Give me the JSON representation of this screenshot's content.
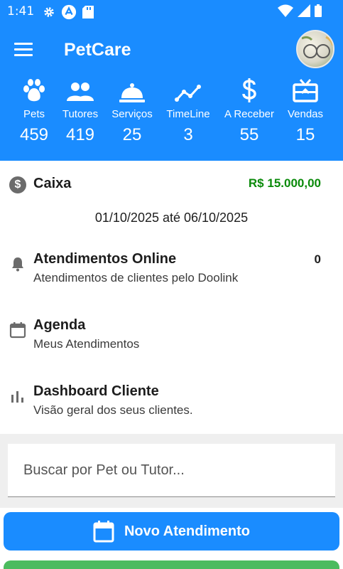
{
  "status_bar": {
    "time": "1:41"
  },
  "header": {
    "app_title": "PetCare"
  },
  "stats": [
    {
      "icon": "paw-icon",
      "label": "Pets",
      "value": "459"
    },
    {
      "icon": "people-icon",
      "label": "Tutores",
      "value": "419"
    },
    {
      "icon": "service-bell-icon",
      "label": "Serviços",
      "value": "25"
    },
    {
      "icon": "timeline-icon",
      "label": "TimeLine",
      "value": "3"
    },
    {
      "icon": "dollar-icon",
      "label": "A Receber",
      "value": "55"
    },
    {
      "icon": "gift-card-icon",
      "label": "Vendas",
      "value": "15"
    }
  ],
  "caixa": {
    "title": "Caixa",
    "value": "R$ 15.000,00",
    "period": "01/10/2025 até 06/10/2025"
  },
  "menu": [
    {
      "icon": "bell-icon",
      "title": "Atendimentos Online",
      "subtitle": "Atendimentos de clientes pelo Doolink",
      "count": "0"
    },
    {
      "icon": "calendar-icon",
      "title": "Agenda",
      "subtitle": "Meus Atendimentos"
    },
    {
      "icon": "bar-chart-icon",
      "title": "Dashboard Cliente",
      "subtitle": "Visão geral dos seus clientes."
    }
  ],
  "search": {
    "placeholder": "Buscar por Pet ou Tutor..."
  },
  "actions": {
    "novo_atendimento": "Novo Atendimento"
  },
  "colors": {
    "primary": "#1a8cff",
    "success": "#0a8a0a",
    "green_button": "#4cbb5f"
  }
}
